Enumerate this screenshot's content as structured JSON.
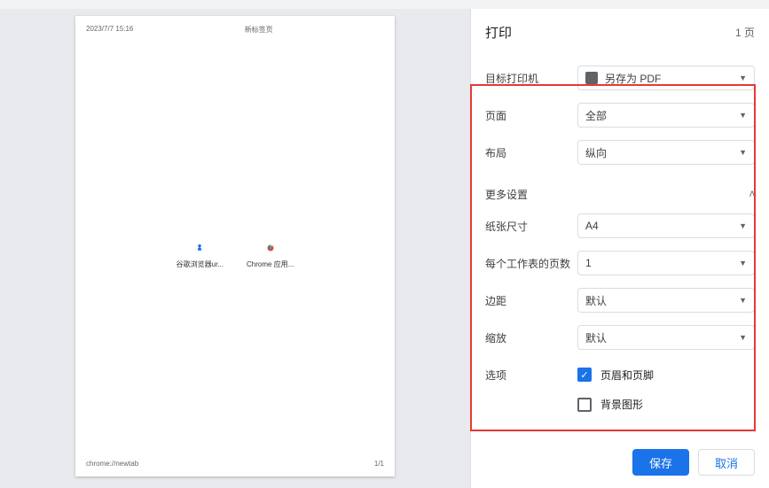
{
  "preview": {
    "header_left": "2023/7/7 15:16",
    "header_center": "新标签页",
    "footer_left": "chrome://newtab",
    "footer_right": "1/1",
    "icons": [
      {
        "label": "谷歌浏览器ur..."
      },
      {
        "label": "Chrome 应用..."
      }
    ]
  },
  "panel": {
    "title": "打印",
    "sheets": "1 页",
    "destination_label": "目标打印机",
    "destination_value": "另存为 PDF",
    "pages_label": "页面",
    "pages_value": "全部",
    "layout_label": "布局",
    "layout_value": "纵向",
    "more_settings": "更多设置",
    "paper_size_label": "纸张尺寸",
    "paper_size_value": "A4",
    "pages_per_sheet_label": "每个工作表的页数",
    "pages_per_sheet_value": "1",
    "margins_label": "边距",
    "margins_value": "默认",
    "scale_label": "缩放",
    "scale_value": "默认",
    "options_label": "选项",
    "option_headers": "页眉和页脚",
    "option_headers_checked": true,
    "option_background": "背景图形",
    "option_background_checked": false,
    "save": "保存",
    "cancel": "取消"
  }
}
